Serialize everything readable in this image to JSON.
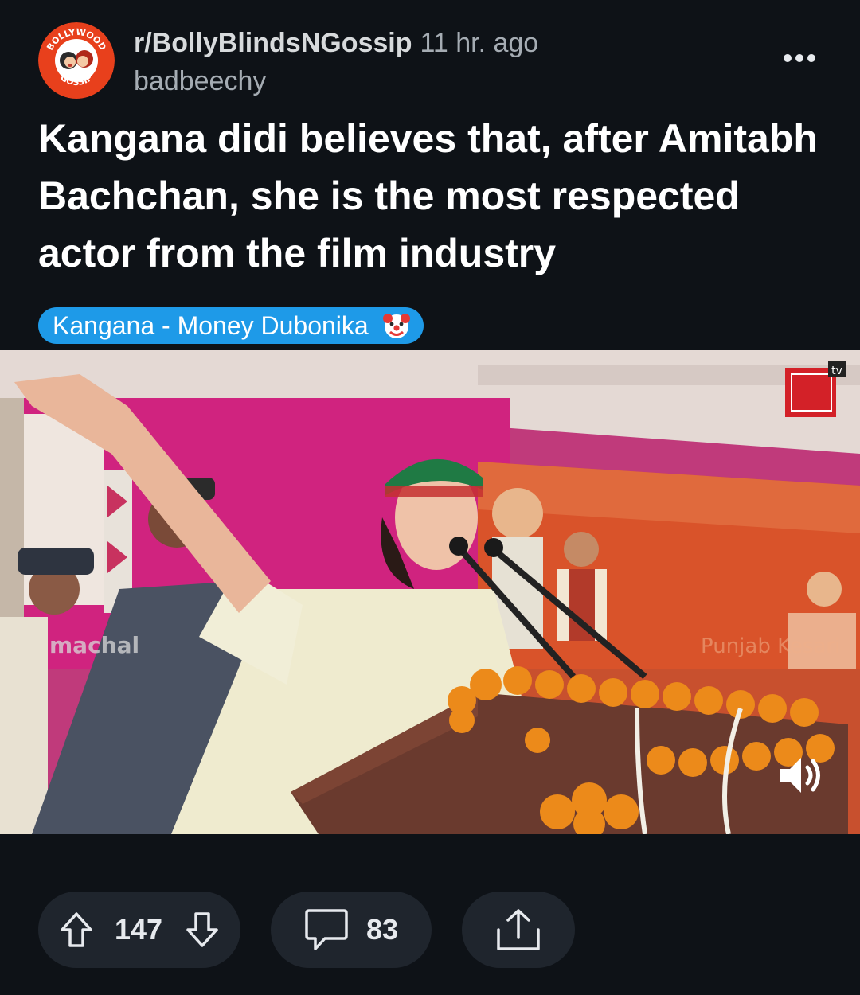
{
  "post": {
    "subreddit": "r/BollyBlindsNGossip",
    "time_ago": "11 hr. ago",
    "author": "badbeechy",
    "title": "Kangana didi believes that, after Amitabh Bachchan, she is the most respected actor from the film industry",
    "flair": {
      "text": "Kangana - Money Dubonika",
      "emoji": "clown-face-icon",
      "color": "#1e9ae8"
    }
  },
  "avatar": {
    "top_text": "BOLLYWOOD",
    "bottom_text": "GOSSIP",
    "color": "#e8401c"
  },
  "media": {
    "overlay_watermark": "machal",
    "overlay_banner_text": "Punjab Kesari",
    "channel_badge": "tv",
    "sound_icon": "speaker-icon"
  },
  "actions": {
    "upvotes": "147",
    "comments": "83",
    "upvote_icon": "arrow-up-icon",
    "downvote_icon": "arrow-down-icon",
    "comment_icon": "comment-bubble-icon",
    "share_icon": "share-icon"
  }
}
